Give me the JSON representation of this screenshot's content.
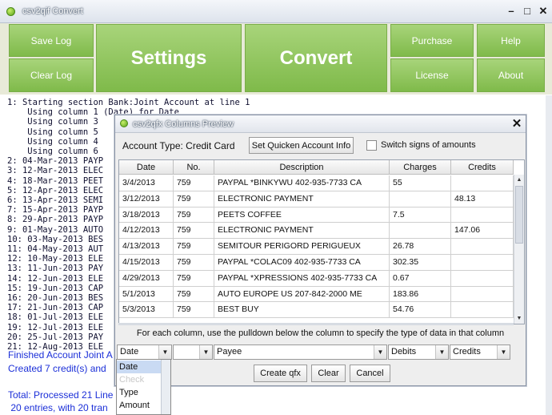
{
  "window": {
    "title": "csv2qif Convert",
    "minimize_glyph": "–",
    "maximize_glyph": "□",
    "close_glyph": "✕"
  },
  "toolbar": {
    "save_log": "Save Log",
    "clear_log": "Clear Log",
    "settings": "Settings",
    "convert": "Convert",
    "purchase": "Purchase",
    "help": "Help",
    "license": "License",
    "about": "About"
  },
  "log": {
    "lines": [
      "1: Starting section Bank:Joint Account at line 1",
      "    Using column 1 (Date) for Date",
      "    Using column 3",
      "    Using column 5",
      "    Using column 4",
      "    Using column 6",
      "2: 04-Mar-2013 PAYP",
      "3: 12-Mar-2013 ELEC",
      "4: 18-Mar-2013 PEET",
      "5: 12-Apr-2013 ELEC",
      "6: 13-Apr-2013 SEMI",
      "7: 15-Apr-2013 PAYP",
      "8: 29-Apr-2013 PAYP",
      "9: 01-May-2013 AUTO",
      "10: 03-May-2013 BES",
      "11: 04-May-2013 AUT",
      "12: 10-May-2013 ELE",
      "13: 11-Jun-2013 PAY",
      "14: 12-Jun-2013 ELE",
      "15: 19-Jun-2013 CAP",
      "16: 20-Jun-2013 BES",
      "17: 21-Jun-2013 CAP",
      "18: 01-Jul-2013 ELE",
      "19: 12-Jul-2013 ELE",
      "20: 25-Jul-2013 PAY",
      "21: 12-Aug-2013 ELE"
    ],
    "summary": [
      "Finished Account Joint A",
      "Created 7 credit(s) and",
      "",
      "Total: Processed 21 Line",
      " 20 entries, with 20 tran"
    ]
  },
  "dialog": {
    "title": "csv2qfx Columns Preview",
    "close_glyph": "✕",
    "account_type": "Account Type: Credit Card",
    "set_quicken_button": "Set Quicken Account Info",
    "switch_signs_label": "Switch signs of amounts",
    "switch_signs_checked": false,
    "columns": [
      "Date",
      "No.",
      "Description",
      "Charges",
      "Credits"
    ],
    "rows": [
      [
        "3/4/2013",
        "759",
        "PAYPAL *BINKYWU 402-935-7733 CA",
        "55",
        ""
      ],
      [
        "3/12/2013",
        "759",
        "ELECTRONIC PAYMENT",
        "",
        "48.13"
      ],
      [
        "3/18/2013",
        "759",
        "PEETS COFFEE",
        "7.5",
        ""
      ],
      [
        "4/12/2013",
        "759",
        "ELECTRONIC PAYMENT",
        "",
        "147.06"
      ],
      [
        "4/13/2013",
        "759",
        "SEMITOUR PERIGORD PERIGUEUX",
        "26.78",
        ""
      ],
      [
        "4/15/2013",
        "759",
        "PAYPAL *COLAC09 402-935-7733 CA",
        "302.35",
        ""
      ],
      [
        "4/29/2013",
        "759",
        "PAYPAL *XPRESSIONS 402-935-7733 CA",
        "0.67",
        ""
      ],
      [
        "5/1/2013",
        "759",
        "AUTO EUROPE US 207-842-2000 ME",
        "183.86",
        ""
      ],
      [
        "5/3/2013",
        "759",
        "BEST BUY",
        "54.76",
        ""
      ]
    ],
    "instructions": "For each column, use the pulldown below the column to specify the type of data in that column",
    "column_types": [
      "Date",
      "",
      "Payee",
      "Debits",
      "Credits"
    ],
    "create_button": "Create qfx",
    "clear_button": "Clear",
    "cancel_button": "Cancel",
    "dropdown_options": [
      "Date",
      "Check",
      "Type",
      "Amount"
    ],
    "dropdown_selected": "Date",
    "scroll_up_glyph": "▲",
    "scroll_down_glyph": "▼",
    "combo_arrow_glyph": "▼"
  }
}
